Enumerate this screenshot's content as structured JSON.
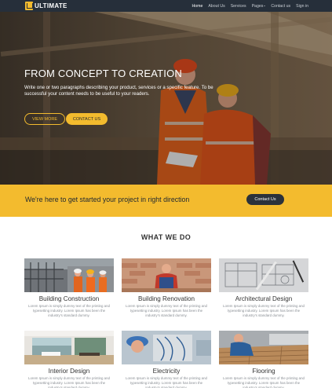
{
  "brand": {
    "name": "ULTIMATE"
  },
  "nav": {
    "items": [
      {
        "label": "Home",
        "active": true
      },
      {
        "label": "About Us",
        "active": false
      },
      {
        "label": "Services",
        "active": false
      },
      {
        "label": "Pages",
        "active": false,
        "dropdown": true
      },
      {
        "label": "Contact us",
        "active": false
      },
      {
        "label": "Sign in",
        "active": false
      }
    ]
  },
  "hero": {
    "title": "FROM CONCEPT TO CREATION",
    "text": "Write one or two paragraphs describing your product, services or a specific feature.  To be successful your content needs to be useful to your readers.",
    "view_more": "VIEW MORE",
    "contact": "CONTACT US"
  },
  "cta": {
    "text": "We're here to get started your project in right direction",
    "button": "Contact Us"
  },
  "services": {
    "title": "WHAT WE DO",
    "items": [
      {
        "title": "Building Construction",
        "desc": "Lorem Ipsum is simply dummy text of the printing and typesetting industry. Lorem Ipsum has been the industry's standard dummy."
      },
      {
        "title": "Building Renovation",
        "desc": "Lorem Ipsum is simply dummy text of the printing and typesetting industry. Lorem Ipsum has been the industry's standard dummy."
      },
      {
        "title": "Architectural Design",
        "desc": "Lorem Ipsum is simply dummy text of the printing and typesetting industry. Lorem Ipsum has been the industry's standard dummy."
      },
      {
        "title": "Interior Design",
        "desc": "Lorem Ipsum is simply dummy text of the printing and typesetting industry. Lorem Ipsum has been the industry's standard dummy."
      },
      {
        "title": "Electricity",
        "desc": "Lorem Ipsum is simply dummy text of the printing and typesetting industry. Lorem Ipsum has been the industry's standard dummy."
      },
      {
        "title": "Flooring",
        "desc": "Lorem Ipsum is simply dummy text of the printing and typesetting industry. Lorem Ipsum has been the industry's standard dummy."
      }
    ]
  },
  "colors": {
    "accent": "#f3bb2e",
    "navbar": "#262f3a",
    "dark_button": "#2b323b"
  },
  "icons": {
    "brand_logo": "u-logo-icon",
    "dropdown": "caret-down-icon"
  }
}
